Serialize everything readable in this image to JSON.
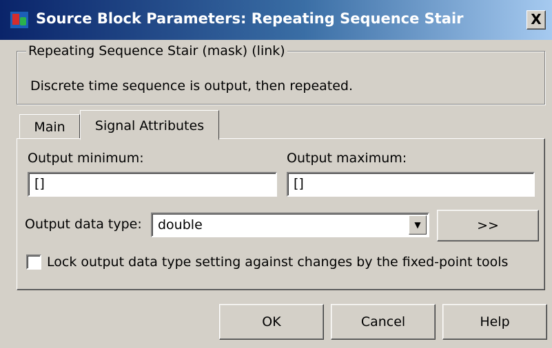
{
  "window": {
    "title": "Source Block Parameters: Repeating Sequence Stair",
    "close_label": "X"
  },
  "group": {
    "legend": "Repeating Sequence Stair (mask) (link)",
    "description": "Discrete time sequence is output, then repeated."
  },
  "tabs": [
    {
      "label": "Main",
      "active": false
    },
    {
      "label": "Signal Attributes",
      "active": true
    }
  ],
  "signal_attributes": {
    "output_minimum": {
      "label": "Output minimum:",
      "value": "[]"
    },
    "output_maximum": {
      "label": "Output maximum:",
      "value": "[]"
    },
    "output_data_type": {
      "label": "Output data type:",
      "value": "double"
    },
    "assistant_button_label": ">>",
    "lock_checkbox": {
      "label": "Lock output data type setting against changes by the fixed-point tools",
      "checked": false
    }
  },
  "buttons": {
    "ok": "OK",
    "cancel": "Cancel",
    "help": "Help"
  },
  "colors": {
    "title_gradient_start": "#0a246a",
    "title_gradient_end": "#a6caf0",
    "dialog_bg": "#d4d0c8"
  }
}
